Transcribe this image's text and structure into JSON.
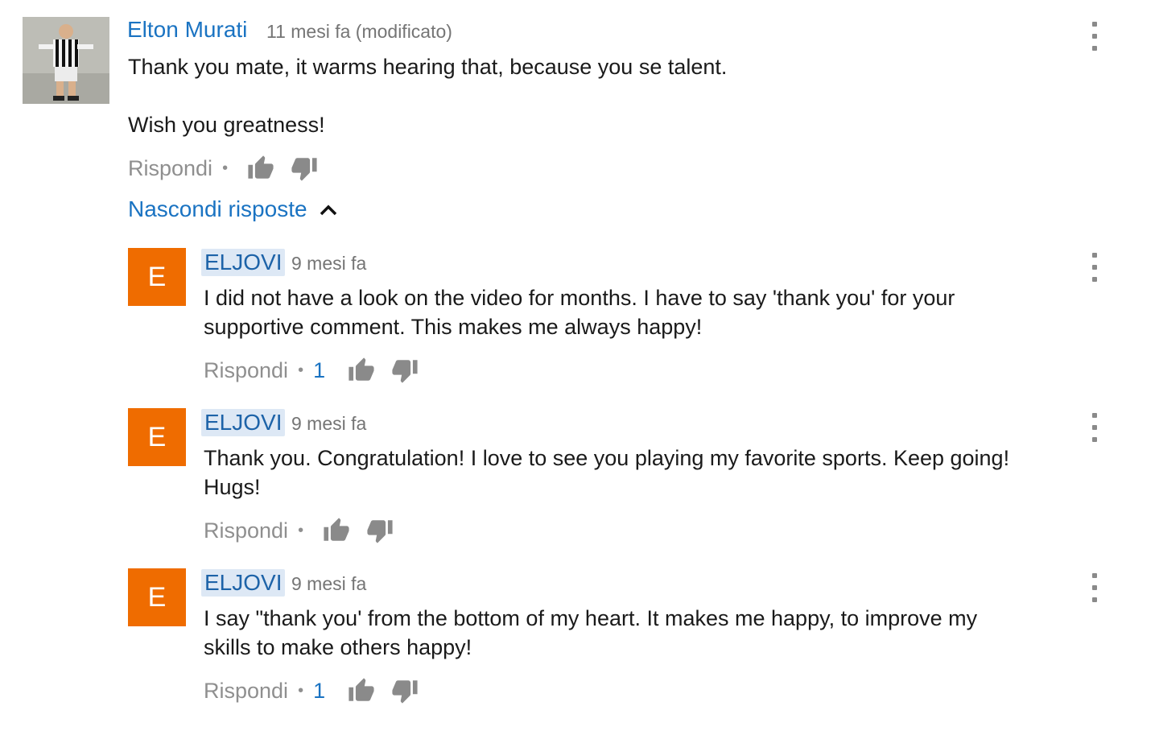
{
  "colors": {
    "link": "#1a73c2",
    "avatar_bg": "#ef6c00",
    "muted": "#8f8f8f"
  },
  "top_comment": {
    "author": "Elton Murati",
    "timestamp": "11 mesi fa (modificato)",
    "body": "Thank you mate, it warms hearing that, because you se talent.\n\nWish you greatness!",
    "reply_label": "Rispondi",
    "avatar_icon": "user-photo",
    "like_icon": "thumbs-up-icon",
    "dislike_icon": "thumbs-down-icon",
    "menu_icon": "more-vertical-icon"
  },
  "replies_toggle": {
    "label": "Nascondi risposte",
    "icon": "chevron-up-icon"
  },
  "replies": [
    {
      "avatar_letter": "E",
      "author": "ELJOVI",
      "timestamp": "9 mesi fa",
      "body": "I did not have a look on the video for months. I have to say 'thank you' for your\nsupportive comment. This makes me always happy!",
      "reply_label": "Rispondi",
      "likes": "1"
    },
    {
      "avatar_letter": "E",
      "author": "ELJOVI",
      "timestamp": "9 mesi fa",
      "body": "Thank you. Congratulation! I love to see you playing my favorite sports. Keep going!\nHugs!",
      "reply_label": "Rispondi",
      "likes": ""
    },
    {
      "avatar_letter": "E",
      "author": "ELJOVI",
      "timestamp": "9 mesi fa",
      "body": "I say \"thank you' from the bottom of my heart. It makes me happy, to improve my\nskills to make others happy!",
      "reply_label": "Rispondi",
      "likes": "1"
    }
  ]
}
